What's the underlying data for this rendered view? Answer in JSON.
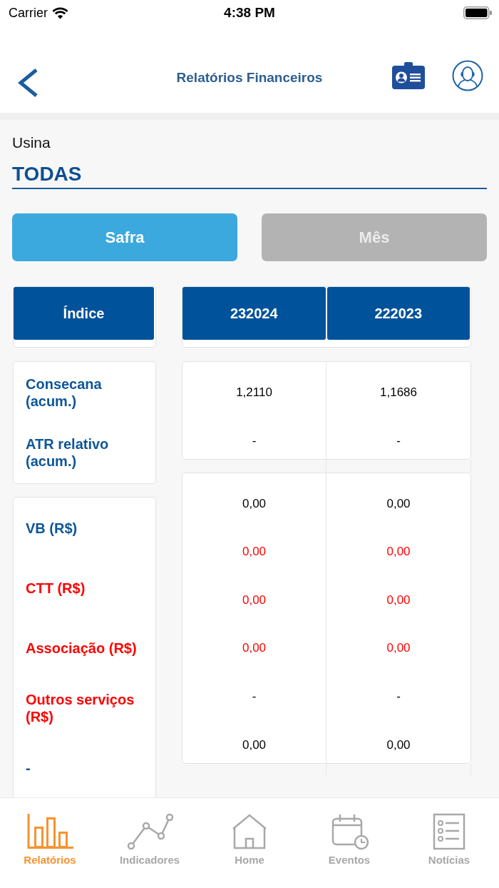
{
  "status_bar": {
    "carrier": "Carrier",
    "time": "4:38 PM"
  },
  "nav_bar": {
    "title": "Relatórios Financeiros"
  },
  "usina": {
    "label": "Usina",
    "value": "TODAS"
  },
  "period_tabs": [
    {
      "label": "Safra",
      "selected": true
    },
    {
      "label": "Mês",
      "selected": false
    }
  ],
  "table": {
    "index_header": "Índice",
    "columns": [
      "232024",
      "222023"
    ],
    "label_groups": [
      {
        "labels": [
          {
            "text": "Consecana (acum.)",
            "color": "#0d5697"
          },
          {
            "text": "ATR relativo (acum.)",
            "color": "#0d5697"
          }
        ]
      },
      {
        "labels": [
          {
            "text": "VB (R$)",
            "color": "#0d5697"
          },
          {
            "text": "CTT (R$)",
            "color": "#ff0000"
          },
          {
            "text": "Associação (R$)",
            "color": "#ff0000"
          },
          {
            "text": "Outros serviços (R$)",
            "color": "#ff0000"
          },
          {
            "text": "-",
            "color": "#0d5697"
          }
        ]
      }
    ],
    "value_groups": [
      {
        "rows": [
          {
            "cells": [
              "1,2110",
              "1,1686"
            ],
            "color": "#000000"
          },
          {
            "cells": [
              "-",
              "-"
            ],
            "color": "#000000"
          }
        ]
      },
      {
        "rows": [
          {
            "cells": [
              "0,00",
              "0,00"
            ],
            "color": "#000000"
          },
          {
            "cells": [
              "0,00",
              "0,00"
            ],
            "color": "#ff0000"
          },
          {
            "cells": [
              "0,00",
              "0,00"
            ],
            "color": "#ff0000"
          },
          {
            "cells": [
              "0,00",
              "0,00"
            ],
            "color": "#ff0000"
          },
          {
            "cells": [
              "-",
              "-"
            ],
            "color": "#000000"
          },
          {
            "cells": [
              "0,00",
              "0,00"
            ],
            "color": "#000000"
          }
        ]
      }
    ]
  },
  "tab_bar": [
    {
      "label": "Relatórios",
      "selected": true
    },
    {
      "label": "Indicadores",
      "selected": false
    },
    {
      "label": "Home",
      "selected": false
    },
    {
      "label": "Eventos",
      "selected": false
    },
    {
      "label": "Notícias",
      "selected": false
    }
  ]
}
